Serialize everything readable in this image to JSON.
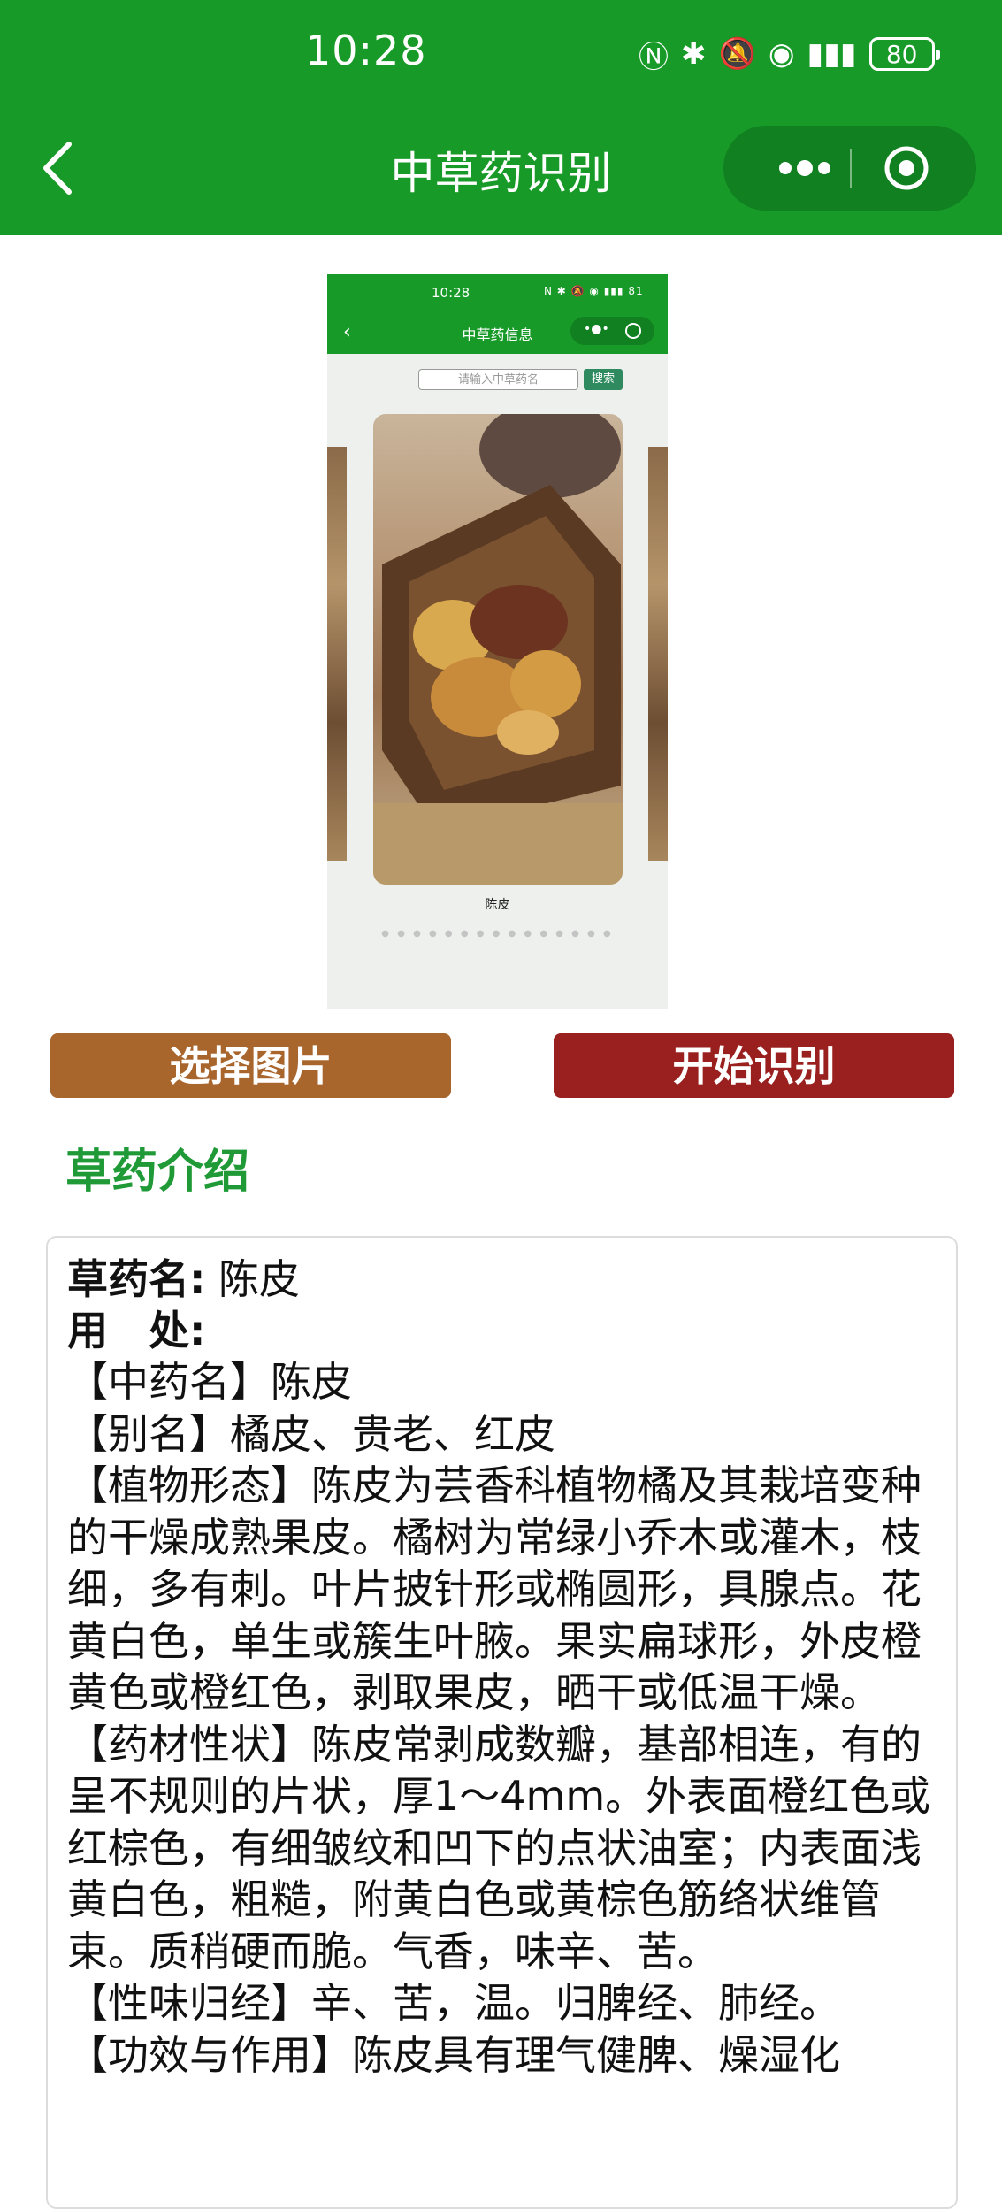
{
  "status_bar": {
    "time": "10:28",
    "icons": [
      "nfc-icon",
      "bluetooth-icon",
      "mute-icon",
      "hotspot-icon",
      "signal-4g-icon"
    ],
    "battery": "80"
  },
  "nav": {
    "title": "中草药识别"
  },
  "preview": {
    "time": "10:28",
    "status": "N ✱ 🔕 ◉ ▮▮▮ 81",
    "title": "中草药信息",
    "search_placeholder": "请输入中草药名",
    "search_button": "搜索",
    "caption": "陈皮",
    "dots": "● ● ● ● ● ● ● ● ● ● ● ● ● ● ●"
  },
  "buttons": {
    "pick": "选择图片",
    "start": "开始识别"
  },
  "section": {
    "title": "草药介绍"
  },
  "info": {
    "name_key": "草药名:",
    "name_value": "陈皮",
    "use_key": "用　处:",
    "description": "【中药名】陈皮\n【别名】橘皮、贵老、红皮\n【植物形态】陈皮为芸香科植物橘及其栽培变种的干燥成熟果皮。橘树为常绿小乔木或灌木，枝细，多有刺。叶片披针形或椭圆形，具腺点。花黄白色，单生或簇生叶腋。果实扁球形，外皮橙黄色或橙红色，剥取果皮，晒干或低温干燥。\n【药材性状】陈皮常剥成数瓣，基部相连，有的呈不规则的片状，厚1～4mm。外表面橙红色或红棕色，有细皱纹和凹下的点状油室；内表面浅黄白色，粗糙，附黄白色或黄棕色筋络状维管束。质稍硬而脆。气香，味辛、苦。\n【性味归经】辛、苦，温。归脾经、肺经。\n【功效与作用】陈皮具有理气健脾、燥湿化"
  }
}
